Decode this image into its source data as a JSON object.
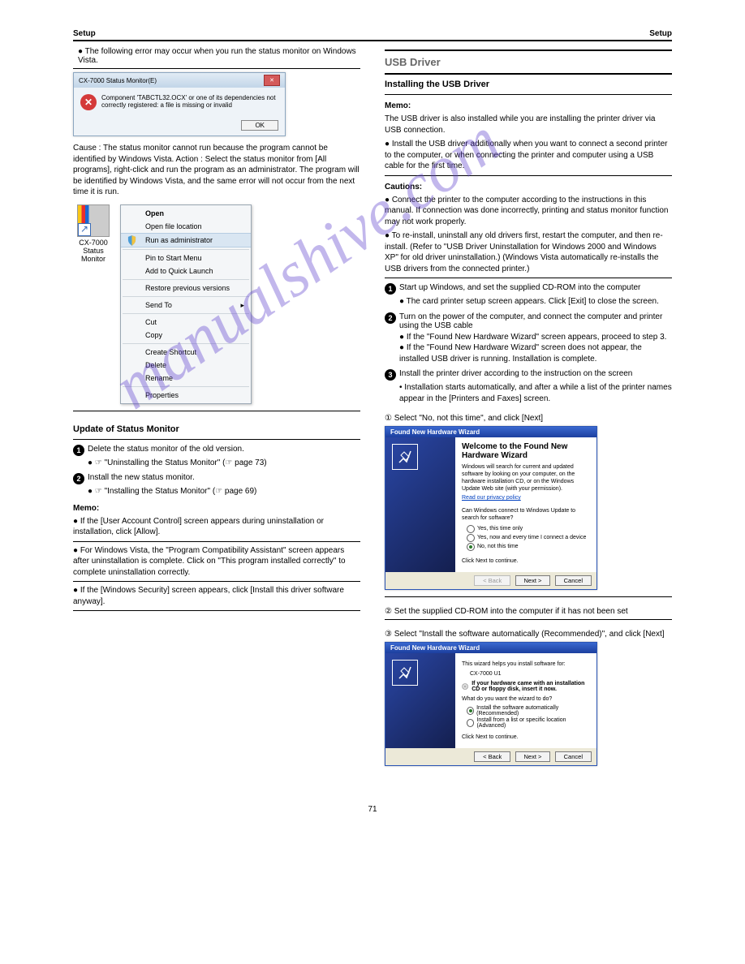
{
  "header": {
    "left": "Setup",
    "right": "Setup"
  },
  "watermark": "manualshive.com",
  "left_col": {
    "pre_lead": "● The following error may occur when you run the status monitor on Windows Vista.",
    "pre_hr": true,
    "error_dialog": {
      "title": "CX-7000 Status Monitor(E)",
      "message": "Component 'TABCTL32.OCX' or one of its dependencies not correctly registered: a file is missing or invalid",
      "ok": "OK"
    },
    "run_admin_intro": "Cause : The status monitor cannot run because the program cannot be identified by Windows Vista. Action : Select the status monitor from [All programs], right-click and run the program as an administrator. The program will be identified by Windows Vista, and the same error will not occur from the next time it is run.",
    "desktop_icon_label": "CX-7000 Status Monitor",
    "ctx_menu": {
      "open": "Open",
      "open_file_location": "Open file location",
      "run_admin": "Run as administrator",
      "pin_start": "Pin to Start Menu",
      "quick_launch": "Add to Quick Launch",
      "restore": "Restore previous versions",
      "send_to": "Send To",
      "cut": "Cut",
      "copy": "Copy",
      "create_shortcut": "Create Shortcut",
      "delete": "Delete",
      "rename": "Rename",
      "properties": "Properties"
    },
    "update_heading": "Update of Status Monitor",
    "update_step1": "Delete the status monitor of the old version.",
    "update_step1_ref": "\"Uninstalling the Status Monitor\" (☞ page 73)",
    "update_step2": "Install the new status monitor.",
    "update_step2_ref": "\"Installing the Status Monitor\" (☞ page 69)",
    "memo_items": [
      "If the [User Account Control] screen appears during uninstallation or installation, click [Allow].",
      "For Windows Vista, the \"Program Compatibility Assistant\" screen appears after uninstallation is complete. Click on \"This program installed correctly\" to complete uninstallation correctly.",
      "If the [Windows Security] screen appears, click [Install this driver software anyway]."
    ]
  },
  "right_col": {
    "usb_heading": "USB Driver",
    "usb_install_heading": "Installing the USB Driver",
    "memo1": "The USB driver is also installed while you are installing the printer driver via USB connection.",
    "bullet1": "Install the USB driver additionally when you want to connect a second printer to the computer, or when connecting the printer and computer using a USB cable for the first time.",
    "caution_label": "Cautions:",
    "caution_list": [
      "Connect the printer to the computer according to the instructions in this manual. If connection was done incorrectly, printing and status monitor function may not work properly.",
      "To re-install, uninstall any old drivers first, restart the computer, and then re-install. (Refer to \"USB Driver Uninstallation for Windows 2000 and Windows XP\" for old driver uninstallation.) (Windows Vista automatically re-installs the USB drivers from the connected printer.)"
    ],
    "step1": "Start up Windows, and set the supplied CD-ROM into the computer",
    "step1_body": "The card printer setup screen appears. Click [Exit] to close the screen.",
    "step2": "Turn on the power of the computer, and connect the computer and printer using the USB cable",
    "step2_bullets": [
      "If the \"Found New Hardware Wizard\" screen appears, proceed to step 3.",
      "If the \"Found New Hardware Wizard\" screen does not appear, the installed USB driver is running. Installation is complete."
    ],
    "step3": "Install the printer driver according to the instruction on the screen",
    "step3_dot": "Installation starts automatically, and after a while a list of the printer names appear in the [Printers and Faxes] screen.",
    "step3_b1": "Select \"No, not this time\", and click [Next]",
    "wizard1": {
      "title": "Found New Hardware Wizard",
      "heading": "Welcome to the Found New Hardware Wizard",
      "intro": "Windows will search for current and updated software by looking on your computer, on the hardware installation CD, or on the Windows Update Web site (with your permission).",
      "privacy": "Read our privacy policy",
      "q": "Can Windows connect to Windows Update to search for software?",
      "opt1": "Yes, this time only",
      "opt2": "Yes, now and every time I connect a device",
      "opt3": "No, not this time",
      "cont": "Click Next to continue.",
      "back": "< Back",
      "next": "Next >",
      "cancel": "Cancel"
    },
    "step3_b2": "Set the supplied CD-ROM into the computer if it has not been set",
    "step3_b3": "Select \"Install the software automatically (Recommended)\", and click [Next]",
    "wizard2": {
      "title": "Found New Hardware Wizard",
      "helps": "This wizard helps you install software for:",
      "device": "CX-7000 U1",
      "cd_tip": "If your hardware came with an installation CD or floppy disk, insert it now.",
      "q": "What do you want the wizard to do?",
      "opt1": "Install the software automatically (Recommended)",
      "opt2": "Install from a list or specific location (Advanced)",
      "cont": "Click Next to continue.",
      "back": "< Back",
      "next": "Next >",
      "cancel": "Cancel"
    }
  },
  "footer": "71"
}
